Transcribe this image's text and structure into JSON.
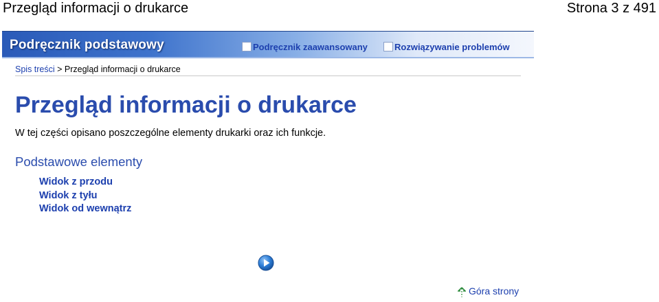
{
  "window": {
    "title": "Przegląd informacji o drukarce",
    "page_counter": "Strona 3 z 491"
  },
  "banner": {
    "title": "Podręcznik podstawowy",
    "advanced_link": "Podręcznik zaawansowany",
    "troubleshooting_link": "Rozwiązywanie problemów"
  },
  "breadcrumb": {
    "root": "Spis treści",
    "separator": " > ",
    "current": "Przegląd informacji o drukarce"
  },
  "main": {
    "heading": "Przegląd informacji o drukarce",
    "intro": "W tej części opisano poszczególne elementy drukarki oraz ich funkcje.",
    "section_heading": "Podstawowe elementy",
    "items": [
      {
        "label": "Widok z przodu"
      },
      {
        "label": "Widok z tyłu"
      },
      {
        "label": "Widok od wewnątrz"
      }
    ]
  },
  "footer": {
    "next_icon": "next-page-arrow-icon",
    "top_link": "Góra strony",
    "top_icon": "up-arrow-icon"
  },
  "colors": {
    "link": "#1c3fae",
    "heading": "#2a4cad",
    "banner_dark": "#2a5ab8",
    "banner_light": "#f4f7fd"
  }
}
